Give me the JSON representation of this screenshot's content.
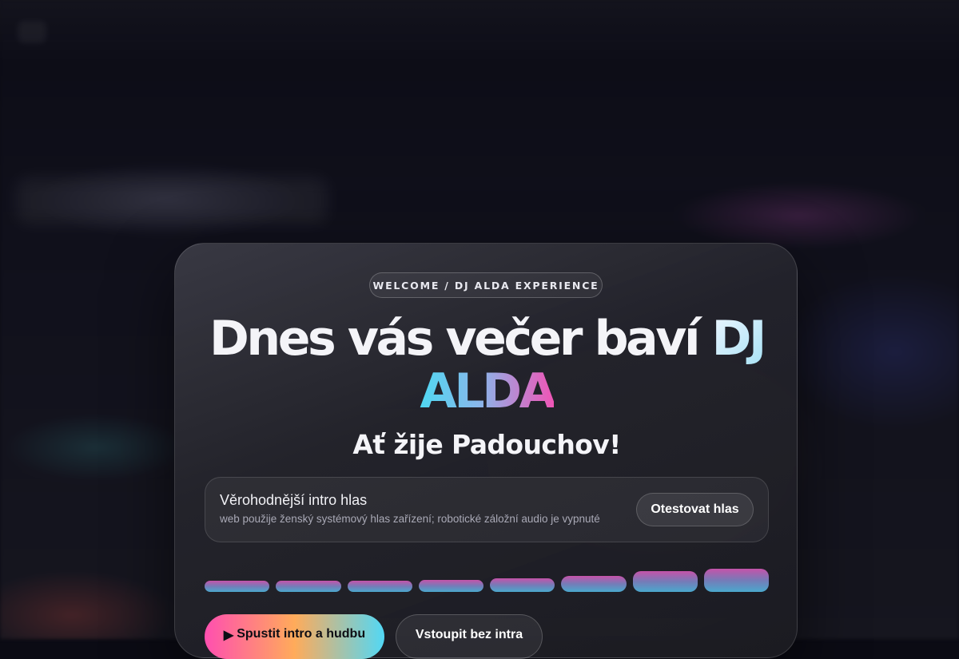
{
  "badge": "WELCOME / DJ ALDA EXPERIENCE",
  "headline": {
    "main": "Dnes vás večer baví ",
    "dj": "DJ",
    "alda": "ALDA"
  },
  "subheadline": "Ať žije Padouchov!",
  "voice": {
    "title": "Věrohodnější intro hlas",
    "description": "web použije ženský systémový hlas zařízení; robotické záložní audio je vypnuté",
    "test_button": "Otestovat hlas"
  },
  "equalizer": {
    "levels": [
      0.4,
      0.4,
      0.4,
      0.45,
      0.5,
      0.6,
      0.75,
      0.85
    ]
  },
  "buttons": {
    "play_icon": "▶",
    "start": "Spustit intro a hudbu",
    "skip": "Vstoupit bez intra"
  },
  "colors": {
    "accent_cyan": "#4fd8f2",
    "accent_pink": "#f055b6",
    "accent_orange": "#ffab5a"
  }
}
